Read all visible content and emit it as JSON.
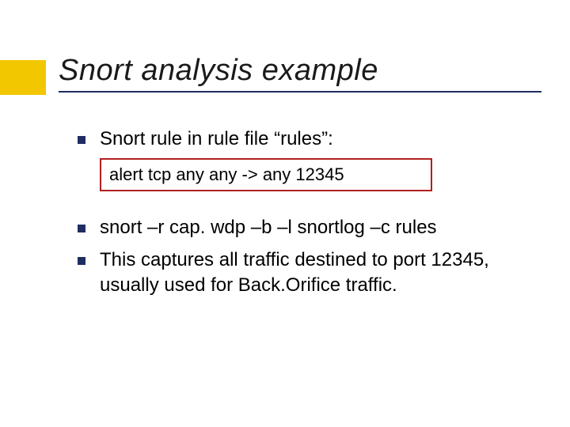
{
  "title": "Snort analysis example",
  "bullets": {
    "b0": "Snort rule in rule file “rules”:",
    "b1": "snort –r cap. wdp –b –l snortlog –c rules",
    "b2": "This captures all traffic destined to port 12345, usually used for Back.Orifice traffic."
  },
  "rulebox": "alert tcp any any -> any 12345",
  "colors": {
    "accent": "#f2c700",
    "rule_border": "#b02020",
    "title_rule": "#1f2d61",
    "bullet": "#1f2d61"
  }
}
